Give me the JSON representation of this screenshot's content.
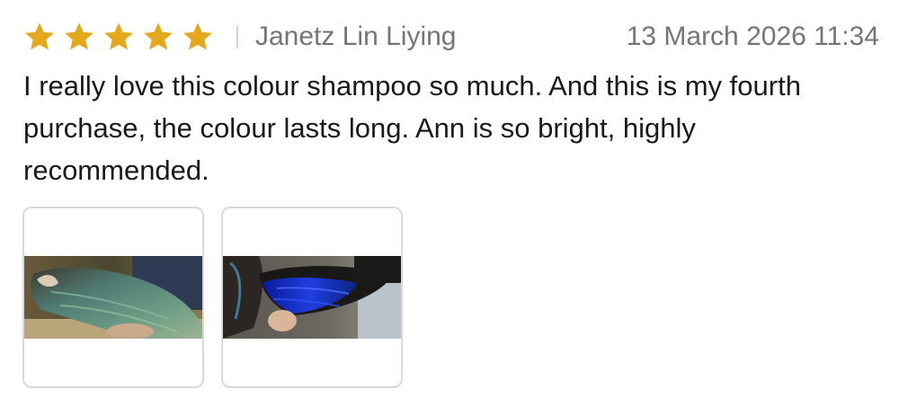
{
  "review": {
    "rating": 5,
    "rating_max": 5,
    "author": "Janetz Lin Liying",
    "date": "13 March 2026 11:34",
    "text": "I really love this colour shampoo so much. And this is my fourth purchase, the colour lasts long. Ann is so bright, highly recommended.",
    "photos_count": 2
  },
  "colors": {
    "star": "#E3A81C",
    "meta_text": "#757575",
    "body_text": "#1A1A1A",
    "thumb_border": "#D9D9D9"
  },
  "icons": [
    "star-icon"
  ]
}
